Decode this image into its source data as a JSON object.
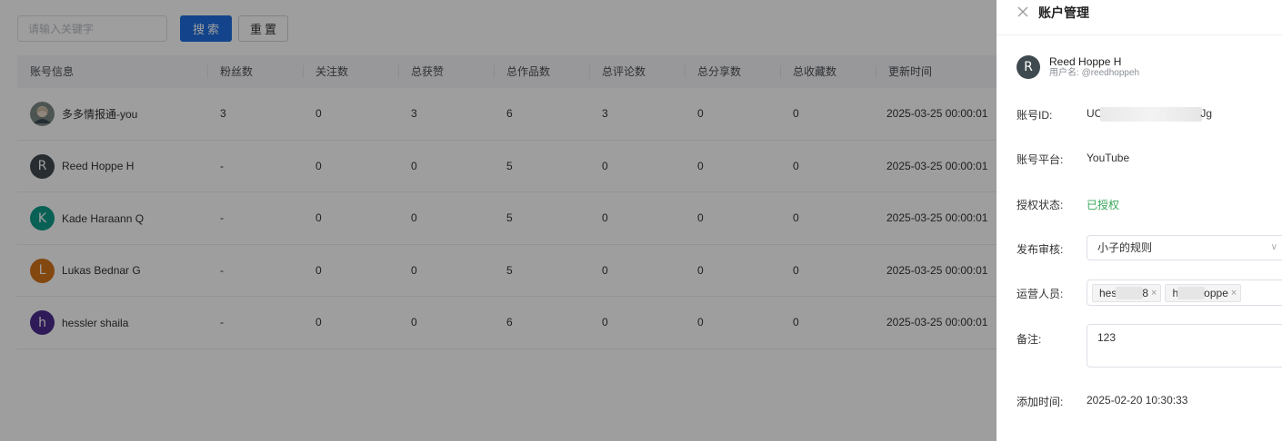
{
  "toolbar": {
    "search_placeholder": "请输入关键字",
    "search_label": "搜索",
    "reset_label": "重置"
  },
  "table": {
    "columns": [
      "账号信息",
      "粉丝数",
      "关注数",
      "总获赞",
      "总作品数",
      "总评论数",
      "总分享数",
      "总收藏数",
      "更新时间"
    ],
    "rows": [
      {
        "avatar": "photo",
        "name": "多多情报通-you",
        "fans": "3",
        "follows": "0",
        "likes": "3",
        "works": "6",
        "comments": "3",
        "shares": "0",
        "favorites": "0",
        "updated": "2025-03-25 00:00:01"
      },
      {
        "avatar": "R",
        "color": "#3f4a50",
        "name": "Reed Hoppe H",
        "fans": "-",
        "follows": "0",
        "likes": "0",
        "works": "5",
        "comments": "0",
        "shares": "0",
        "favorites": "0",
        "updated": "2025-03-25 00:00:01"
      },
      {
        "avatar": "K",
        "color": "#0f9d8a",
        "name": "Kade Haraann Q",
        "fans": "-",
        "follows": "0",
        "likes": "0",
        "works": "5",
        "comments": "0",
        "shares": "0",
        "favorites": "0",
        "updated": "2025-03-25 00:00:01"
      },
      {
        "avatar": "L",
        "color": "#d4731a",
        "name": "Lukas Bednar G",
        "fans": "-",
        "follows": "0",
        "likes": "0",
        "works": "5",
        "comments": "0",
        "shares": "0",
        "favorites": "0",
        "updated": "2025-03-25 00:00:01"
      },
      {
        "avatar": "h",
        "color": "#4b2d8f",
        "name": "hessler shaila",
        "fans": "-",
        "follows": "0",
        "likes": "0",
        "works": "6",
        "comments": "0",
        "shares": "0",
        "favorites": "0",
        "updated": "2025-03-25 00:00:01"
      }
    ]
  },
  "drawer": {
    "title": "账户管理",
    "user": {
      "initial": "R",
      "name": "Reed Hoppe H",
      "handle_label": "用户名:",
      "handle": "@reedhoppeh"
    },
    "id_label": "账号ID:",
    "id_prefix": "UC",
    "id_suffix": "Jg",
    "platform_label": "账号平台:",
    "platform": "YouTube",
    "auth_label": "授权状态:",
    "auth_status": "已授权",
    "review_label": "发布审核:",
    "review_value": "小子的规则",
    "operators_label": "运营人员:",
    "operators": [
      {
        "prefix": "hes",
        "suffix": "8"
      },
      {
        "prefix": "h",
        "suffix": "oppe"
      }
    ],
    "remark_label": "备注:",
    "remark": "123",
    "added_label": "添加时间:",
    "added": "2025-02-20 10:30:33"
  },
  "colors": {
    "primary": "#1f6fe0",
    "success": "#37a85a",
    "mask": "rgba(0,0,0,0.38)"
  }
}
